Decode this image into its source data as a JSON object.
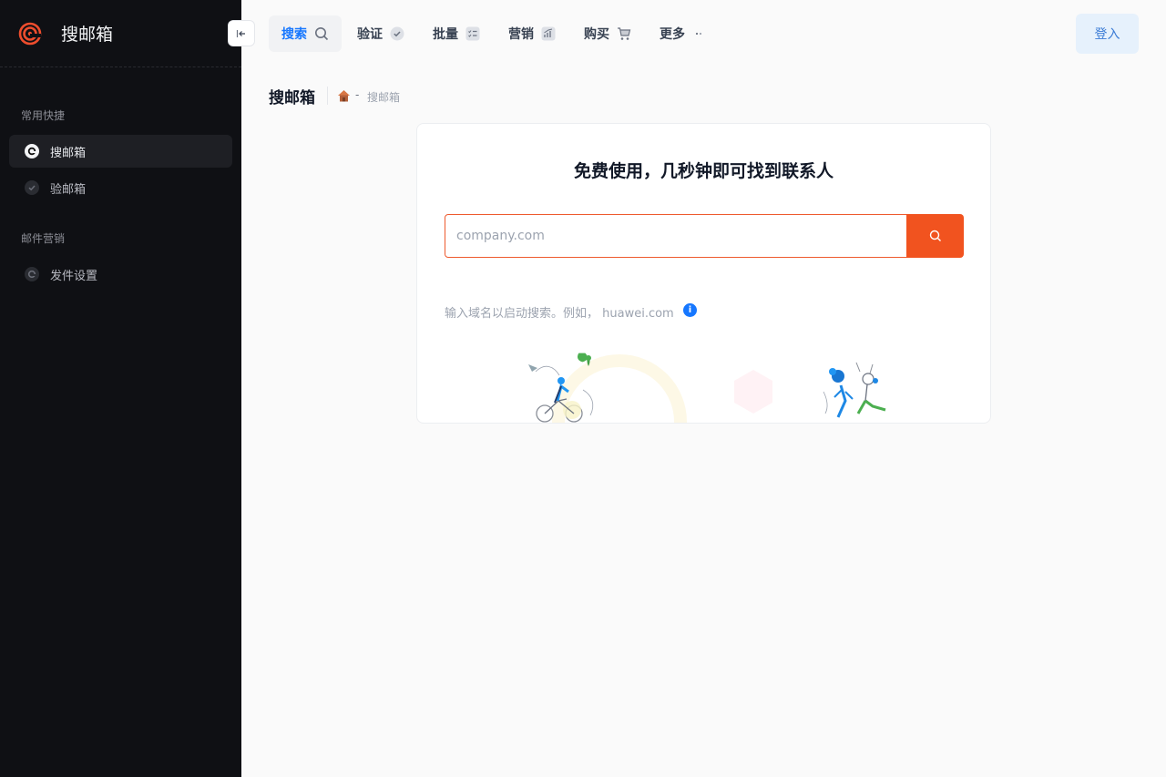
{
  "app": {
    "name": "搜邮箱"
  },
  "sidebar": {
    "sections": [
      {
        "title": "常用快捷",
        "items": [
          {
            "label": "搜邮箱",
            "icon": "search-email-icon",
            "active": true
          },
          {
            "label": "验邮箱",
            "icon": "check-icon",
            "active": false
          }
        ]
      },
      {
        "title": "邮件营销",
        "items": [
          {
            "label": "发件设置",
            "icon": "send-settings-icon",
            "active": false
          }
        ]
      }
    ]
  },
  "nav": {
    "items": [
      {
        "label": "搜索",
        "icon": "search-icon",
        "active": true
      },
      {
        "label": "验证",
        "icon": "check-circle-icon"
      },
      {
        "label": "批量",
        "icon": "list-icon"
      },
      {
        "label": "营销",
        "icon": "chart-icon"
      },
      {
        "label": "购买",
        "icon": "cart-icon"
      },
      {
        "label": "更多",
        "icon": "more-icon"
      }
    ],
    "login": "登入"
  },
  "page": {
    "title": "搜邮箱",
    "breadcrumb": {
      "separator": "-",
      "current": "搜邮箱"
    }
  },
  "card": {
    "headline": "免费使用，几秒钟即可找到联系人",
    "search": {
      "placeholder": "company.com",
      "value": ""
    },
    "hint": "输入域名以启动搜索。例如， huawei.com"
  },
  "colors": {
    "accent": "#f1531f",
    "link": "#1677ff",
    "sidebar_bg": "#0f1014"
  }
}
